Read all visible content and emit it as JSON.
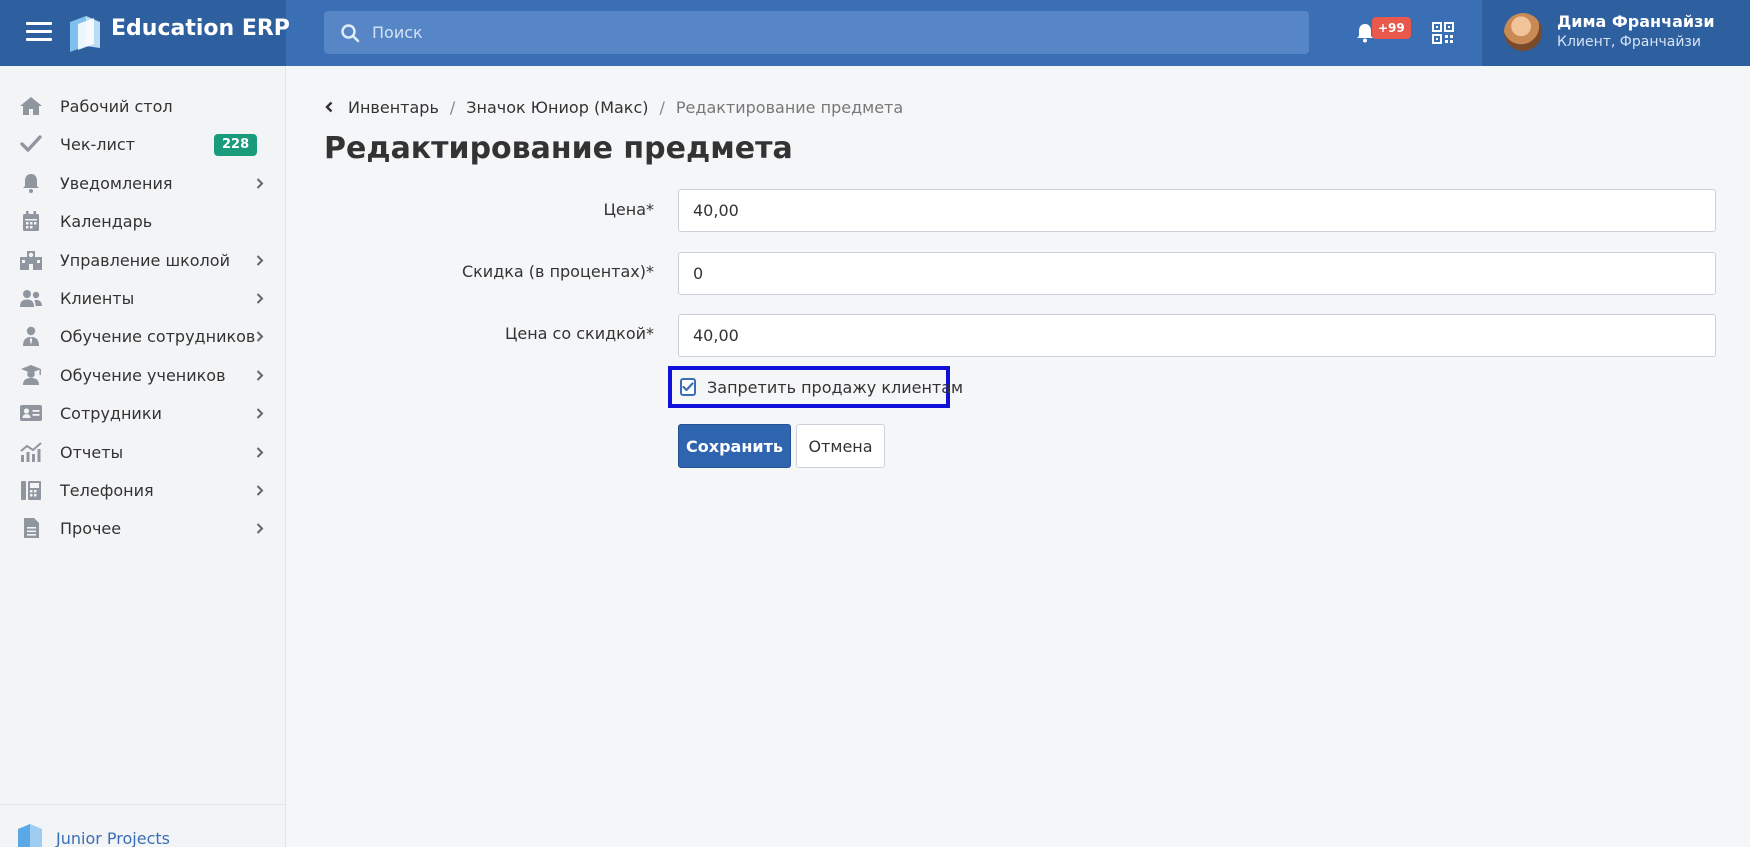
{
  "app": {
    "name": "Education ERP"
  },
  "search": {
    "placeholder": "Поиск"
  },
  "notifications": {
    "badge": "+99"
  },
  "user": {
    "name": "Дима Франчайзи",
    "role": "Клиент, Франчайзи"
  },
  "sidebar": {
    "items": [
      {
        "label": "Рабочий стол",
        "icon": "home-icon"
      },
      {
        "label": "Чек-лист",
        "icon": "check-icon",
        "badge": "228"
      },
      {
        "label": "Уведомления",
        "icon": "bell-icon",
        "has_submenu": true
      },
      {
        "label": "Календарь",
        "icon": "calendar-icon"
      },
      {
        "label": "Управление школой",
        "icon": "school-icon",
        "has_submenu": true
      },
      {
        "label": "Клиенты",
        "icon": "users-icon",
        "has_submenu": true
      },
      {
        "label": "Обучение сотрудников",
        "icon": "staff-training-icon",
        "has_submenu": true
      },
      {
        "label": "Обучение учеников",
        "icon": "graduation-icon",
        "has_submenu": true
      },
      {
        "label": "Сотрудники",
        "icon": "id-card-icon",
        "has_submenu": true
      },
      {
        "label": "Отчеты",
        "icon": "chart-icon",
        "has_submenu": true
      },
      {
        "label": "Телефония",
        "icon": "fax-icon",
        "has_submenu": true
      },
      {
        "label": "Прочее",
        "icon": "document-icon",
        "has_submenu": true
      }
    ],
    "footer": {
      "label": "Junior Projects"
    }
  },
  "breadcrumb": {
    "items": [
      "Инвентарь",
      "Значок Юниор (Макс)"
    ],
    "current": "Редактирование предмета",
    "separator": "/"
  },
  "page": {
    "title": "Редактирование предмета"
  },
  "form": {
    "price": {
      "label": "Цена*",
      "value": "40,00"
    },
    "discount": {
      "label": "Скидка (в процентах)*",
      "value": "0"
    },
    "discounted_price": {
      "label": "Цена со скидкой*",
      "value": "40,00"
    },
    "forbid_sale": {
      "label": "Запретить продажу клиентам",
      "checked": true
    },
    "save_label": "Сохранить",
    "cancel_label": "Отмена"
  },
  "colors": {
    "header": "#3a6eb5",
    "header_dark": "#2e5f9f",
    "primary_button": "#2f64ae",
    "badge_green": "#1a9b7c",
    "badge_red": "#e8594c",
    "highlight": "#1010d8"
  }
}
